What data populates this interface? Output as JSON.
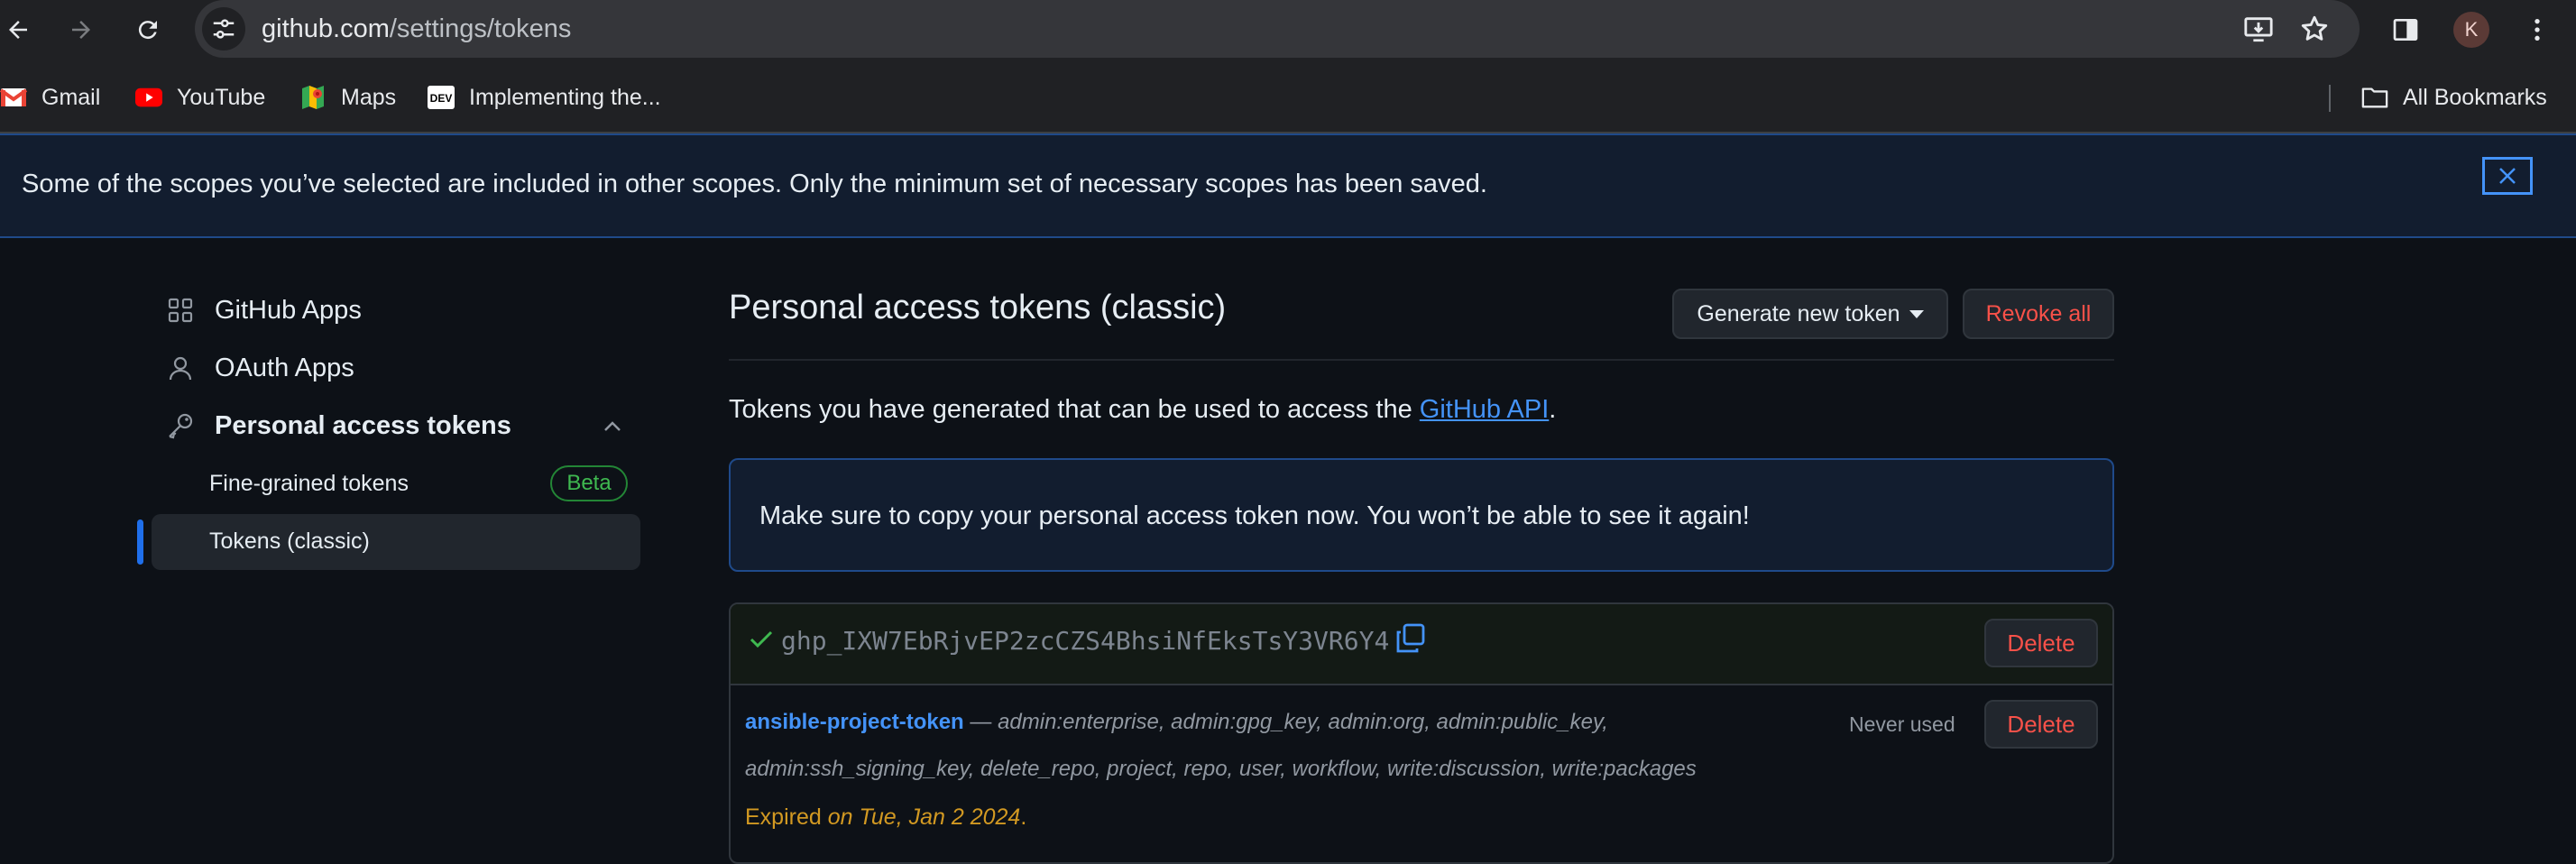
{
  "browser": {
    "url_host": "github.com",
    "url_path": "/settings/tokens",
    "profile_initial": "K",
    "bookmarks": [
      {
        "label": "Gmail",
        "icon": "gmail-icon"
      },
      {
        "label": "YouTube",
        "icon": "youtube-icon"
      },
      {
        "label": "Maps",
        "icon": "maps-icon"
      },
      {
        "label": "Implementing the...",
        "icon": "dev-icon"
      }
    ],
    "all_bookmarks_label": "All Bookmarks",
    "dev_badge": "DEV"
  },
  "flash": {
    "message": "Some of the scopes you’ve selected are included in other scopes. Only the minimum set of necessary scopes has been saved."
  },
  "sidebar": {
    "items": [
      {
        "label": "GitHub Apps",
        "icon": "apps-grid-icon"
      },
      {
        "label": "OAuth Apps",
        "icon": "person-icon"
      },
      {
        "label": "Personal access tokens",
        "icon": "key-icon"
      }
    ],
    "sub_items": [
      {
        "label": "Fine-grained tokens",
        "badge": "Beta"
      },
      {
        "label": "Tokens (classic)"
      }
    ]
  },
  "main": {
    "title": "Personal access tokens (classic)",
    "generate_label": "Generate new token",
    "revoke_label": "Revoke all",
    "intro_text": "Tokens you have generated that can be used to access the ",
    "intro_link": "GitHub API",
    "intro_end": ".",
    "notice": "Make sure to copy your personal access token now. You won’t be able to see it again!",
    "new_token": {
      "value": "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",
      "delete_label": "Delete"
    },
    "token": {
      "name": "ansible-project-token",
      "dash": " — ",
      "scopes": "admin:enterprise, admin:gpg_key, admin:org, admin:public_key, admin:ssh_signing_key, delete_repo, project, repo, user, workflow, write:discussion, write:packages",
      "last_used": "Never used",
      "delete_label": "Delete",
      "expired_prefix": "Expired ",
      "expired_date": "on Tue, Jan 2 2024",
      "expired_end": "."
    }
  },
  "colors": {
    "accent": "#4493f8",
    "danger": "#f85149",
    "success": "#3fb950",
    "warning": "#d29922",
    "background": "#0d1117"
  }
}
